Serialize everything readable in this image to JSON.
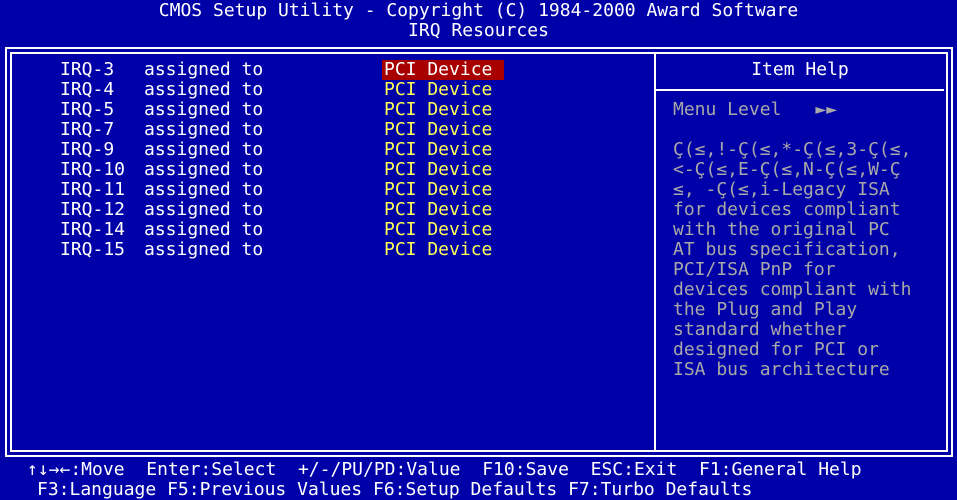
{
  "header": {
    "title": "CMOS Setup Utility - Copyright (C) 1984-2000 Award Software",
    "subtitle": "IRQ Resources"
  },
  "settings": [
    {
      "label": "IRQ-3",
      "assign": "assigned to",
      "value": "PCI Device",
      "selected": true
    },
    {
      "label": "IRQ-4",
      "assign": "assigned to",
      "value": "PCI Device",
      "selected": false
    },
    {
      "label": "IRQ-5",
      "assign": "assigned to",
      "value": "PCI Device",
      "selected": false
    },
    {
      "label": "IRQ-7",
      "assign": "assigned to",
      "value": "PCI Device",
      "selected": false
    },
    {
      "label": "IRQ-9",
      "assign": "assigned to",
      "value": "PCI Device",
      "selected": false
    },
    {
      "label": "IRQ-10",
      "assign": "assigned to",
      "value": "PCI Device",
      "selected": false
    },
    {
      "label": "IRQ-11",
      "assign": "assigned to",
      "value": "PCI Device",
      "selected": false
    },
    {
      "label": "IRQ-12",
      "assign": "assigned to",
      "value": "PCI Device",
      "selected": false
    },
    {
      "label": "IRQ-14",
      "assign": "assigned to",
      "value": "PCI Device",
      "selected": false
    },
    {
      "label": "IRQ-15",
      "assign": "assigned to",
      "value": "PCI Device",
      "selected": false
    }
  ],
  "help": {
    "title": "Item Help",
    "menu_level_label": "Menu Level",
    "menu_level_arrows": "►►",
    "lines": [
      "Ç(≤,!-Ç(≤,*-Ç(≤,3-Ç(≤,",
      "<-Ç(≤,E-Ç(≤,N-Ç(≤,W-Ç",
      "≤, -Ç(≤,i-Legacy ISA",
      "for devices compliant",
      "with the original PC",
      "AT bus specification,",
      "PCI/ISA PnP for",
      "devices compliant with",
      "the Plug and Play",
      "standard whether",
      "designed for PCI or",
      "ISA bus architecture"
    ]
  },
  "footer": {
    "line1": [
      {
        "key": "↑↓→←",
        "action": "Move"
      },
      {
        "key": "Enter",
        "action": "Select"
      },
      {
        "key": "+/-/PU/PD",
        "action": "Value"
      },
      {
        "key": "F10",
        "action": "Save"
      },
      {
        "key": "ESC",
        "action": "Exit"
      },
      {
        "key": "F1",
        "action": "General Help"
      }
    ],
    "line2": [
      {
        "key": "F3",
        "action": "Language"
      },
      {
        "key": "F5",
        "action": "Previous Values"
      },
      {
        "key": "F6",
        "action": "Setup Defaults"
      },
      {
        "key": "F7",
        "action": "Turbo Defaults"
      }
    ]
  },
  "colors": {
    "background": "#0000a8",
    "value_text": "#ffff54",
    "selected_bg": "#a80000",
    "help_text": "#a8a8a8",
    "border": "#ffffff"
  }
}
